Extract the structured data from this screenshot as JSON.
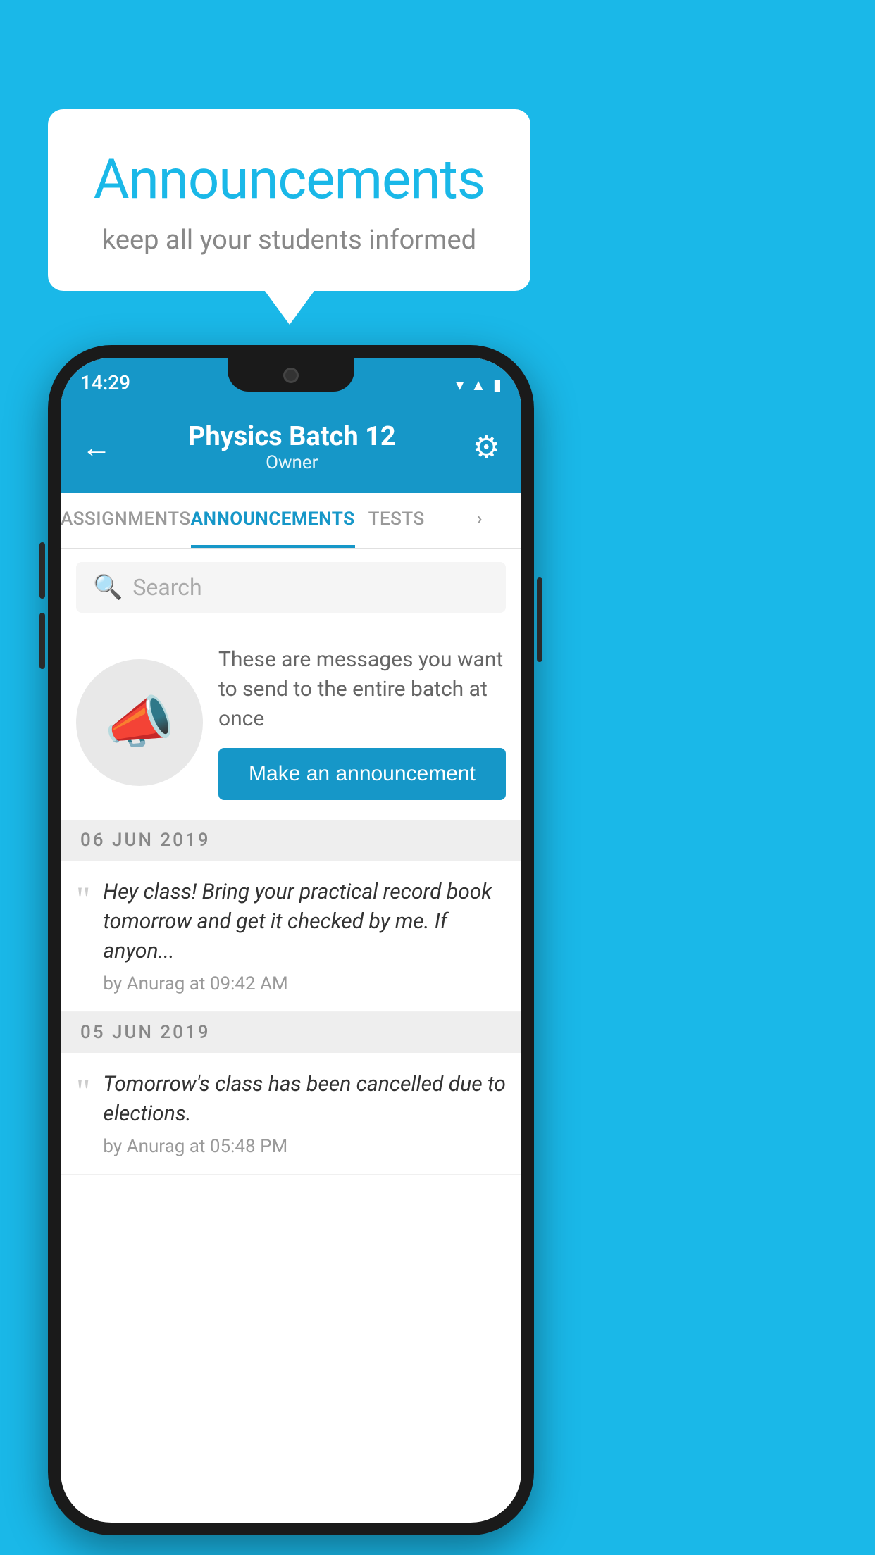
{
  "background_color": "#1ab8e8",
  "speech_bubble": {
    "title": "Announcements",
    "subtitle": "keep all your students informed"
  },
  "phone": {
    "status_bar": {
      "time": "14:29",
      "icons": [
        "wifi",
        "signal",
        "battery"
      ]
    },
    "header": {
      "title": "Physics Batch 12",
      "subtitle": "Owner",
      "back_label": "←",
      "gear_label": "⚙"
    },
    "tabs": [
      {
        "label": "ASSIGNMENTS",
        "active": false
      },
      {
        "label": "ANNOUNCEMENTS",
        "active": true
      },
      {
        "label": "TESTS",
        "active": false
      },
      {
        "label": "...",
        "active": false
      }
    ],
    "search": {
      "placeholder": "Search"
    },
    "promo": {
      "description": "These are messages you want to send to the entire batch at once",
      "button_label": "Make an announcement"
    },
    "announcements": [
      {
        "date": "06  JUN  2019",
        "text": "Hey class! Bring your practical record book tomorrow and get it checked by me. If anyon...",
        "meta": "by Anurag at 09:42 AM"
      },
      {
        "date": "05  JUN  2019",
        "text": "Tomorrow's class has been cancelled due to elections.",
        "meta": "by Anurag at 05:48 PM"
      }
    ]
  }
}
